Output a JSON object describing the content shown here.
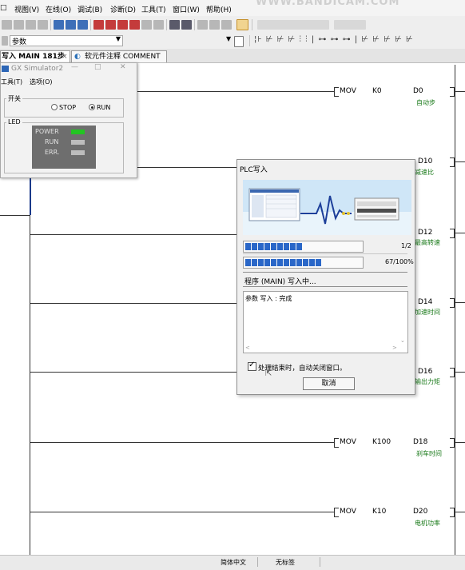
{
  "menu": [
    "视图(V)",
    "在线(O)",
    "调试(B)",
    "诊断(D)",
    "工具(T)",
    "窗口(W)",
    "帮助(H)"
  ],
  "watermark": "WWW.BANDICAM.COM",
  "toolbar2": {
    "combo_value": "参数",
    "ladder_symbols": "¦⊦ ⊬ ⊬ ⊬ ⫶ ⫶ | ⊶ ⊶ ⊶ | ⊬ ⊬ ⊬ ⊬ ⊬"
  },
  "tabs": {
    "main": "写入 MAIN 181步",
    "comment": "软元件注释 COMMENT"
  },
  "ladder": [
    {
      "instr": "MOV",
      "src": "K0",
      "dst": "D0",
      "comment": "自动步"
    },
    {
      "instr": "",
      "src": "",
      "dst": "D10",
      "comment": "减速比"
    },
    {
      "instr": "",
      "src": "",
      "dst": "D12",
      "comment": "最高转速"
    },
    {
      "instr": "",
      "src": "",
      "dst": "D14",
      "comment": "加速时间"
    },
    {
      "instr": "",
      "src": "",
      "dst": "D16",
      "comment": "输出力矩"
    },
    {
      "instr": "MOV",
      "src": "K100",
      "dst": "D18",
      "comment": "刹车时间"
    },
    {
      "instr": "MOV",
      "src": "K10",
      "dst": "D20",
      "comment": "电机功率"
    }
  ],
  "simulator": {
    "title": "GX Simulator2",
    "menu": [
      "工具(T)",
      "选项(O)"
    ],
    "switch_label": "开关",
    "stop_label": "STOP",
    "run_label": "RUN",
    "selected": "RUN",
    "led_label": "LED",
    "leds": [
      {
        "name": "POWER",
        "color": "#22c522"
      },
      {
        "name": "RUN",
        "color": "#bdbdbd"
      },
      {
        "name": "ERR.",
        "color": "#bdbdbd"
      }
    ]
  },
  "dialog": {
    "title": "PLC写入",
    "step_text": "1/2",
    "step_fraction": 0.5,
    "percent_text": "67/100%",
    "percent_fraction": 0.67,
    "status": "程序 (MAIN) 写入中...",
    "log": "参数 写入 : 完成",
    "auto_close_label": "处理结束时，自动关闭窗口。",
    "auto_close_checked": true,
    "close_button": "取消"
  },
  "statusbar": {
    "lang": "简体中文",
    "label": "无标签"
  }
}
